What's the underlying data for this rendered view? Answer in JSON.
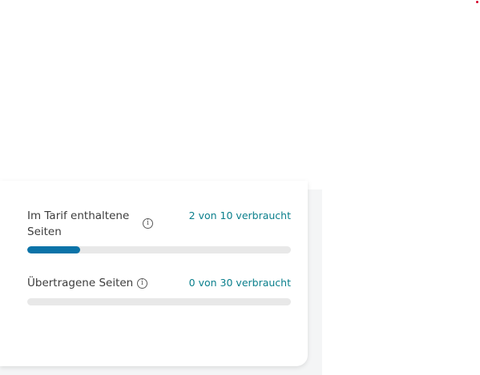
{
  "usage": {
    "items": [
      {
        "label": "Im Tarif enthaltene Seiten",
        "usage_text": "2 von 10 verbraucht",
        "used": 2,
        "total": 10,
        "fraction": 0.2
      },
      {
        "label": "Übertragene Seiten",
        "usage_text": "0 von 30 verbraucht",
        "used": 0,
        "total": 30,
        "fraction": 0
      }
    ]
  },
  "colors": {
    "accent_text": "#0a7f8c",
    "progress_fill": "#0b73a8",
    "progress_track": "#e8e8e8",
    "notification_dot": "#d6002a"
  },
  "icons": {
    "info": "info-icon"
  }
}
